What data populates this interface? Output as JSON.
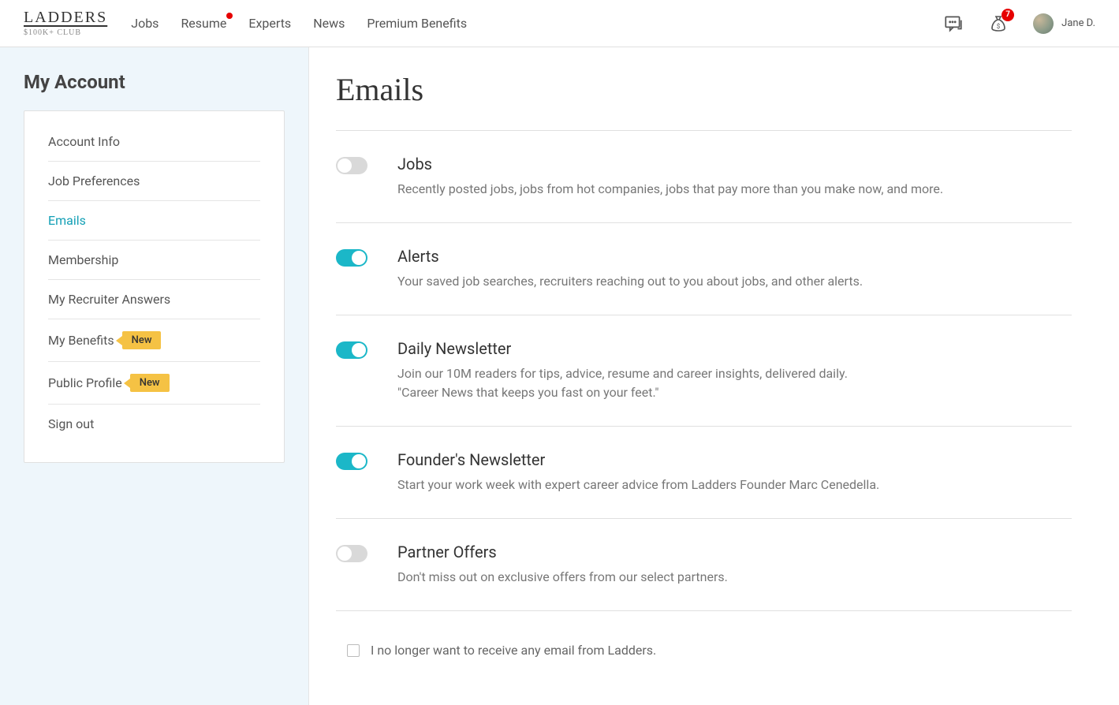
{
  "header": {
    "logo_main": "LADDERS",
    "logo_sub": "$100K+ CLUB",
    "nav": [
      {
        "label": "Jobs",
        "has_dot": false
      },
      {
        "label": "Resume",
        "has_dot": true
      },
      {
        "label": "Experts",
        "has_dot": false
      },
      {
        "label": "News",
        "has_dot": false
      },
      {
        "label": "Premium Benefits",
        "has_dot": false
      }
    ],
    "notifications_badge": "7",
    "user_name": "Jane D."
  },
  "sidebar": {
    "title": "My Account",
    "items": [
      {
        "label": "Account Info",
        "active": false,
        "new": false
      },
      {
        "label": "Job Preferences",
        "active": false,
        "new": false
      },
      {
        "label": "Emails",
        "active": true,
        "new": false
      },
      {
        "label": "Membership",
        "active": false,
        "new": false
      },
      {
        "label": "My Recruiter Answers",
        "active": false,
        "new": false
      },
      {
        "label": "My Benefits",
        "active": false,
        "new": true
      },
      {
        "label": "Public Profile",
        "active": false,
        "new": true
      },
      {
        "label": "Sign out",
        "active": false,
        "new": false
      }
    ],
    "new_label": "New"
  },
  "main": {
    "title": "Emails",
    "sections": [
      {
        "title": "Jobs",
        "desc_lines": [
          "Recently posted jobs, jobs from hot companies, jobs that pay more than you make now, and more."
        ],
        "on": false
      },
      {
        "title": "Alerts",
        "desc_lines": [
          "Your saved job searches, recruiters reaching out to you about jobs, and other alerts."
        ],
        "on": true
      },
      {
        "title": "Daily Newsletter",
        "desc_lines": [
          "Join our 10M readers for tips, advice, resume and career insights, delivered daily.",
          "\"Career News that keeps you fast on your feet.\""
        ],
        "on": true
      },
      {
        "title": "Founder's Newsletter",
        "desc_lines": [
          "Start your work week with expert career advice from Ladders Founder Marc Cenedella."
        ],
        "on": true
      },
      {
        "title": "Partner Offers",
        "desc_lines": [
          "Don't miss out on exclusive offers from our select partners."
        ],
        "on": false
      }
    ],
    "unsubscribe_label": "I no longer want to receive any email from Ladders."
  }
}
